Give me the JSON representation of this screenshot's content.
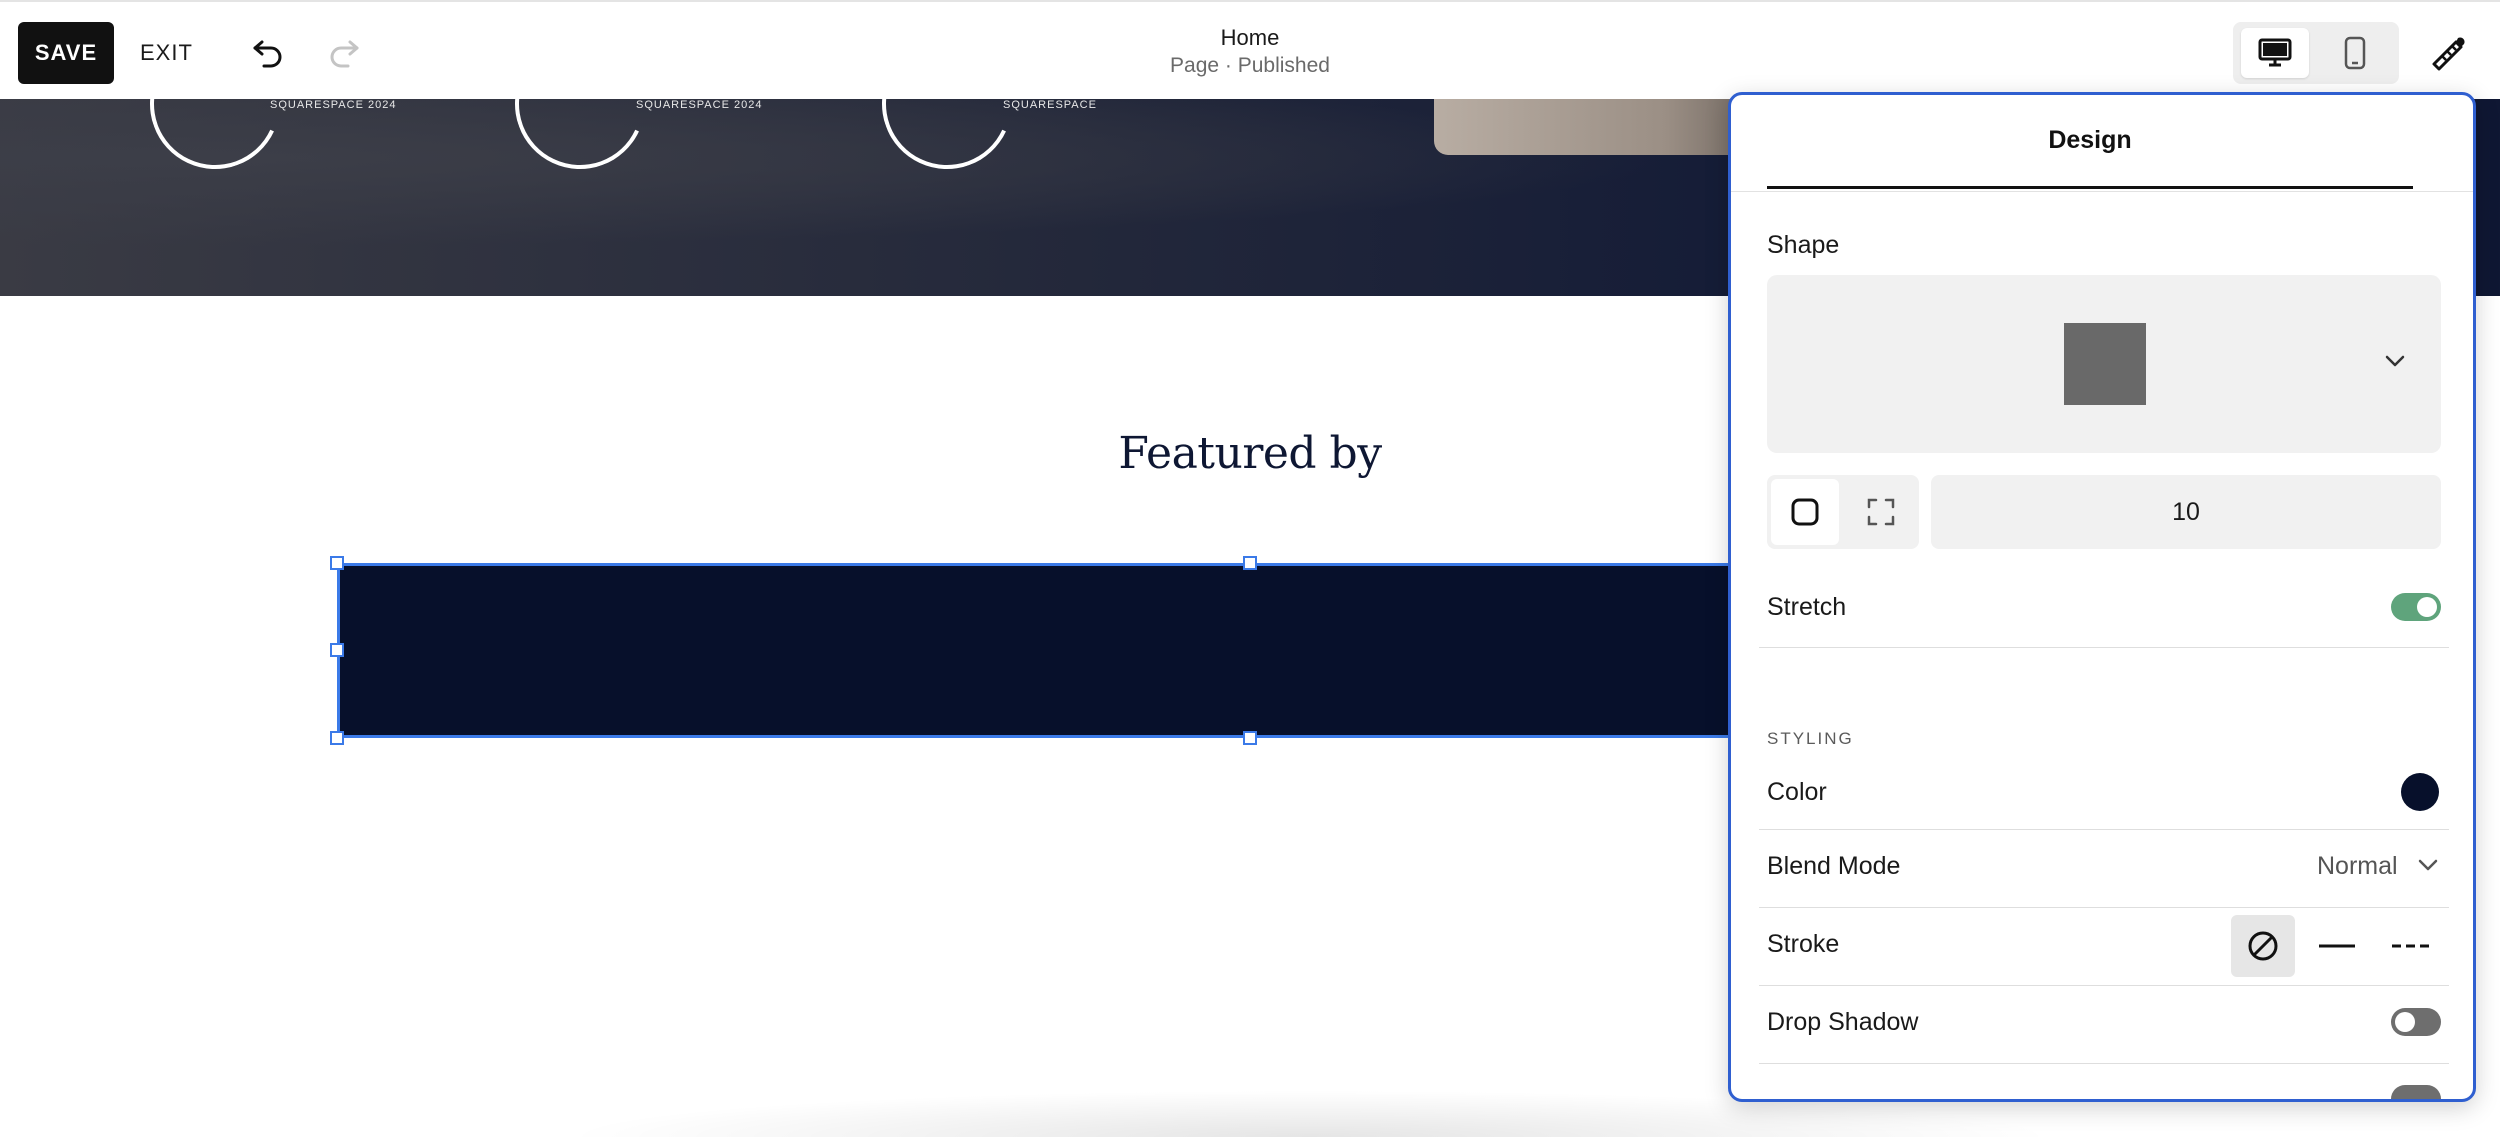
{
  "toolbar": {
    "save_label": "SAVE",
    "exit_label": "EXIT",
    "undo_icon": "undo-icon",
    "redo_icon": "redo-icon",
    "page_title": "Home",
    "page_status": "Page · Published",
    "device_options": [
      "desktop-icon",
      "mobile-icon"
    ],
    "selected_device": "desktop",
    "style_icon": "paintbrush-ruler-icon"
  },
  "canvas": {
    "award_labels": [
      "SQUARESPACE 2024",
      "SQUARESPACE 2024",
      "SQUARESPACE"
    ],
    "heading": "Featured by",
    "shape_color": "#07102b",
    "selection_color": "#3b7ae8"
  },
  "design_panel": {
    "tab_label": "Design",
    "shape_label": "Shape",
    "shape_preview_color": "#696969",
    "corner_radius_value": "10",
    "stretch_label": "Stretch",
    "stretch_on": true,
    "styling_header": "STYLING",
    "color_label": "Color",
    "color_value": "#07102b",
    "blend_mode_label": "Blend Mode",
    "blend_mode_value": "Normal",
    "stroke_label": "Stroke",
    "stroke_options": [
      "none-icon",
      "solid-line-icon",
      "dashed-line-icon"
    ],
    "stroke_selected": "none",
    "drop_shadow_label": "Drop Shadow",
    "drop_shadow_on": false,
    "accent_color": "#2f5fd0",
    "toggle_on_color": "#5fa47c"
  }
}
